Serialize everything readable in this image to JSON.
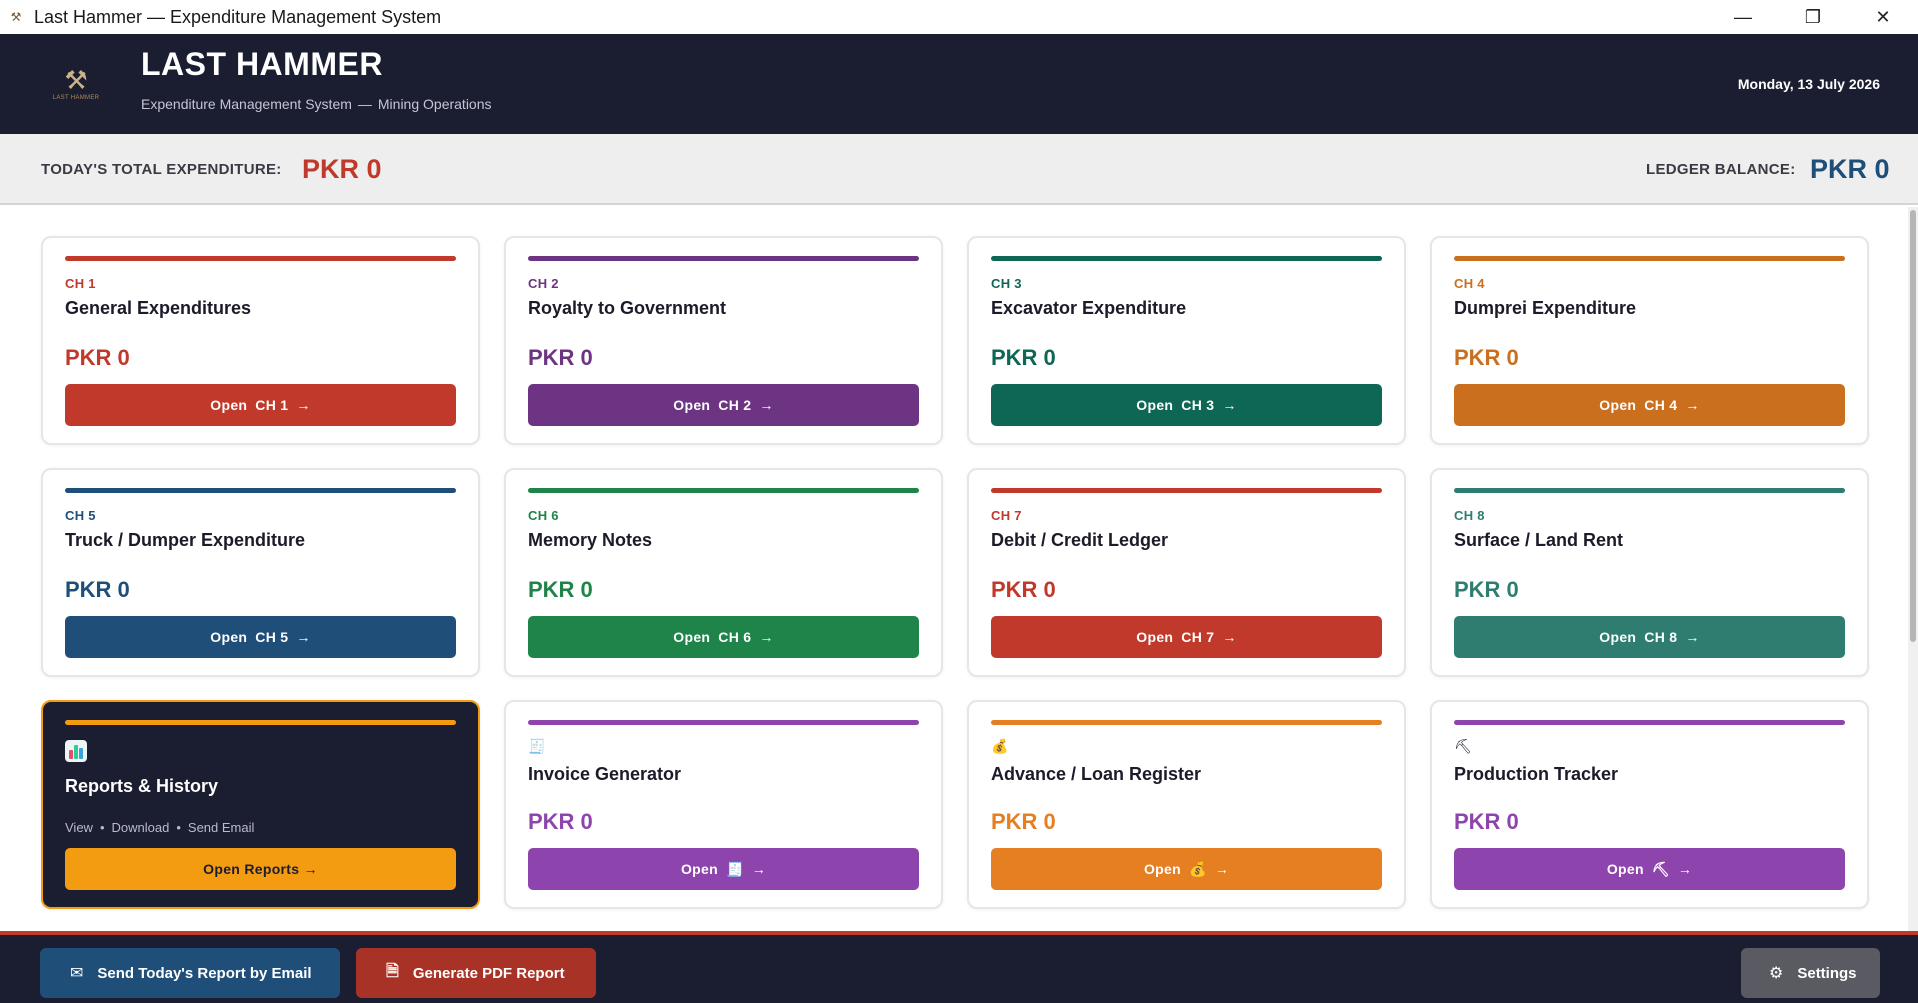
{
  "window": {
    "title": "Last Hammer — Expenditure Management System",
    "app_icon": "hammer-icon",
    "controls": {
      "minimize": "—",
      "restore": "❐",
      "close": "✕"
    }
  },
  "header": {
    "title": "LAST HAMMER",
    "subtitle_left": "Expenditure Management System",
    "subtitle_sep": "—",
    "subtitle_right": "Mining Operations",
    "date": "Monday, 13 July 2026",
    "logo_text": "LAST HAMMER"
  },
  "summary": {
    "today_label": "TODAY'S TOTAL EXPENDITURE:",
    "today_value": "PKR 0",
    "ledger_label": "LEDGER BALANCE:",
    "ledger_value": "PKR 0"
  },
  "chapters": [
    {
      "ch": "CH 1",
      "name": "General Expenditures",
      "amount": "PKR 0",
      "btn": "Open",
      "btn_ch": "CH 1",
      "arrow": "→",
      "color": "#c0392b"
    },
    {
      "ch": "CH 2",
      "name": "Royalty to Government",
      "amount": "PKR 0",
      "btn": "Open",
      "btn_ch": "CH 2",
      "arrow": "→",
      "color": "#6c3483"
    },
    {
      "ch": "CH 3",
      "name": "Excavator Expenditure",
      "amount": "PKR 0",
      "btn": "Open",
      "btn_ch": "CH 3",
      "arrow": "→",
      "color": "#0e6655"
    },
    {
      "ch": "CH 4",
      "name": "Dumprei Expenditure",
      "amount": "PKR 0",
      "btn": "Open",
      "btn_ch": "CH 4",
      "arrow": "→",
      "color": "#ca6f1e"
    },
    {
      "ch": "CH 5",
      "name": "Truck / Dumper Expenditure",
      "amount": "PKR 0",
      "btn": "Open",
      "btn_ch": "CH 5",
      "arrow": "→",
      "color": "#1f4e79"
    },
    {
      "ch": "CH 6",
      "name": "Memory Notes",
      "amount": "PKR 0",
      "btn": "Open",
      "btn_ch": "CH 6",
      "arrow": "→",
      "color": "#1e8449"
    },
    {
      "ch": "CH 7",
      "name": "Debit / Credit Ledger",
      "amount": "PKR 0",
      "btn": "Open",
      "btn_ch": "CH 7",
      "arrow": "→",
      "color": "#c0392b"
    },
    {
      "ch": "CH 8",
      "name": "Surface / Land Rent",
      "amount": "PKR 0",
      "btn": "Open",
      "btn_ch": "CH 8",
      "arrow": "→",
      "color": "#2e7d70"
    }
  ],
  "reports": {
    "icon": "bar-chart-icon",
    "name": "Reports & History",
    "link_view": "View",
    "link_download": "Download",
    "link_email": "Send Email",
    "dot": "•",
    "btn": "Open Reports →",
    "accent": "#f39c12"
  },
  "tools": [
    {
      "icon": "receipt-icon",
      "glyph": "🧾",
      "name": "Invoice Generator",
      "amount": "PKR 0",
      "btn": "Open",
      "arrow": "→",
      "color": "#8e44ad"
    },
    {
      "icon": "money-bag-icon",
      "glyph": "💰",
      "name": "Advance / Loan Register",
      "amount": "PKR 0",
      "btn": "Open",
      "arrow": "→",
      "color": "#e67e22"
    },
    {
      "icon": "pick-icon",
      "glyph": "⛏",
      "name": "Production Tracker",
      "amount": "PKR 0",
      "btn": "Open",
      "arrow": "→",
      "color": "#8e44ad"
    }
  ],
  "footer": {
    "email_btn": "Send Today's Report by Email",
    "email_icon": "envelope-icon",
    "pdf_btn": "Generate PDF Report",
    "pdf_icon": "document-icon",
    "settings_btn": "Settings",
    "settings_icon": "gear-icon"
  }
}
